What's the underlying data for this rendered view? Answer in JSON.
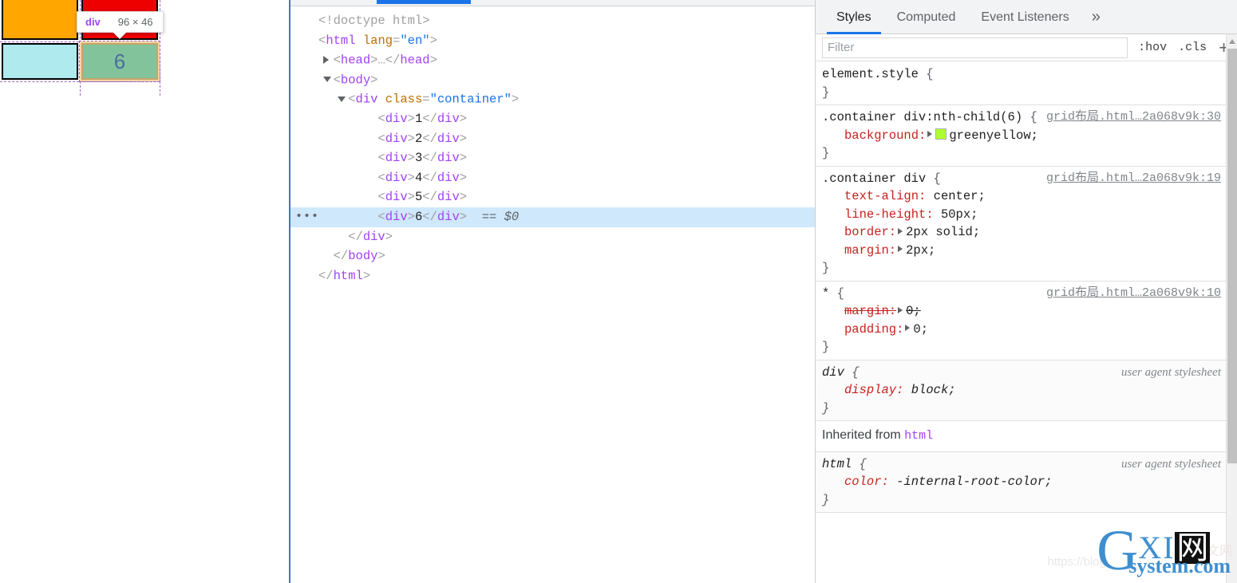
{
  "page": {
    "cells": [
      {
        "label": "",
        "color": "#ffa600",
        "name": "grid-cell-orange"
      },
      {
        "label": "",
        "color": "#ef0000",
        "name": "grid-cell-red"
      },
      {
        "label": "",
        "color": "#aeeaee",
        "name": "grid-cell-cyan"
      },
      {
        "label": "6",
        "color": "greenyellow",
        "name": "grid-cell-selected"
      }
    ],
    "tooltip": {
      "tag": "div",
      "dimensions": "96 × 46"
    }
  },
  "dom": {
    "lines": [
      {
        "indent": 0,
        "triangle": "none",
        "segments": [
          {
            "t": "<!doctype html>",
            "c": "doctype"
          }
        ]
      },
      {
        "indent": 0,
        "triangle": "none",
        "segments": [
          {
            "t": "<",
            "c": "punc"
          },
          {
            "t": "html",
            "c": "tag"
          },
          {
            "t": " ",
            "c": "punc"
          },
          {
            "t": "lang",
            "c": "attr"
          },
          {
            "t": "=",
            "c": "punc"
          },
          {
            "t": "\"en\"",
            "c": "val"
          },
          {
            "t": ">",
            "c": "punc"
          }
        ]
      },
      {
        "indent": 1,
        "triangle": "closed",
        "segments": [
          {
            "t": "<",
            "c": "punc"
          },
          {
            "t": "head",
            "c": "tag"
          },
          {
            "t": ">",
            "c": "punc"
          },
          {
            "t": "…",
            "c": "punc"
          },
          {
            "t": "</",
            "c": "punc"
          },
          {
            "t": "head",
            "c": "tag"
          },
          {
            "t": ">",
            "c": "punc"
          }
        ]
      },
      {
        "indent": 1,
        "triangle": "open",
        "segments": [
          {
            "t": "<",
            "c": "punc"
          },
          {
            "t": "body",
            "c": "tag"
          },
          {
            "t": ">",
            "c": "punc"
          }
        ]
      },
      {
        "indent": 2,
        "triangle": "open",
        "segments": [
          {
            "t": "<",
            "c": "punc"
          },
          {
            "t": "div",
            "c": "tag"
          },
          {
            "t": " ",
            "c": "punc"
          },
          {
            "t": "class",
            "c": "attr"
          },
          {
            "t": "=",
            "c": "punc"
          },
          {
            "t": "\"container\"",
            "c": "val"
          },
          {
            "t": ">",
            "c": "punc"
          }
        ]
      },
      {
        "indent": 4,
        "triangle": "none",
        "segments": [
          {
            "t": "<",
            "c": "punc"
          },
          {
            "t": "div",
            "c": "tag"
          },
          {
            "t": ">",
            "c": "punc"
          },
          {
            "t": "1",
            "c": "txt"
          },
          {
            "t": "</",
            "c": "punc"
          },
          {
            "t": "div",
            "c": "tag"
          },
          {
            "t": ">",
            "c": "punc"
          }
        ]
      },
      {
        "indent": 4,
        "triangle": "none",
        "segments": [
          {
            "t": "<",
            "c": "punc"
          },
          {
            "t": "div",
            "c": "tag"
          },
          {
            "t": ">",
            "c": "punc"
          },
          {
            "t": "2",
            "c": "txt"
          },
          {
            "t": "</",
            "c": "punc"
          },
          {
            "t": "div",
            "c": "tag"
          },
          {
            "t": ">",
            "c": "punc"
          }
        ]
      },
      {
        "indent": 4,
        "triangle": "none",
        "segments": [
          {
            "t": "<",
            "c": "punc"
          },
          {
            "t": "div",
            "c": "tag"
          },
          {
            "t": ">",
            "c": "punc"
          },
          {
            "t": "3",
            "c": "txt"
          },
          {
            "t": "</",
            "c": "punc"
          },
          {
            "t": "div",
            "c": "tag"
          },
          {
            "t": ">",
            "c": "punc"
          }
        ]
      },
      {
        "indent": 4,
        "triangle": "none",
        "segments": [
          {
            "t": "<",
            "c": "punc"
          },
          {
            "t": "div",
            "c": "tag"
          },
          {
            "t": ">",
            "c": "punc"
          },
          {
            "t": "4",
            "c": "txt"
          },
          {
            "t": "</",
            "c": "punc"
          },
          {
            "t": "div",
            "c": "tag"
          },
          {
            "t": ">",
            "c": "punc"
          }
        ]
      },
      {
        "indent": 4,
        "triangle": "none",
        "segments": [
          {
            "t": "<",
            "c": "punc"
          },
          {
            "t": "div",
            "c": "tag"
          },
          {
            "t": ">",
            "c": "punc"
          },
          {
            "t": "5",
            "c": "txt"
          },
          {
            "t": "</",
            "c": "punc"
          },
          {
            "t": "div",
            "c": "tag"
          },
          {
            "t": ">",
            "c": "punc"
          }
        ]
      },
      {
        "indent": 4,
        "triangle": "none",
        "selected": true,
        "ellipsis": "•••",
        "segments": [
          {
            "t": "<",
            "c": "punc"
          },
          {
            "t": "div",
            "c": "tag"
          },
          {
            "t": ">",
            "c": "punc"
          },
          {
            "t": "6",
            "c": "txt"
          },
          {
            "t": "</",
            "c": "punc"
          },
          {
            "t": "div",
            "c": "tag"
          },
          {
            "t": ">",
            "c": "punc"
          },
          {
            "t": "  == $0",
            "c": "eqdollar"
          }
        ]
      },
      {
        "indent": 2,
        "triangle": "none",
        "segments": [
          {
            "t": "</",
            "c": "punc"
          },
          {
            "t": "div",
            "c": "tag"
          },
          {
            "t": ">",
            "c": "punc"
          }
        ]
      },
      {
        "indent": 1,
        "triangle": "none",
        "segments": [
          {
            "t": "</",
            "c": "punc"
          },
          {
            "t": "body",
            "c": "tag"
          },
          {
            "t": ">",
            "c": "punc"
          }
        ]
      },
      {
        "indent": 0,
        "triangle": "none",
        "segments": [
          {
            "t": "</",
            "c": "punc"
          },
          {
            "t": "html",
            "c": "tag"
          },
          {
            "t": ">",
            "c": "punc"
          }
        ]
      }
    ]
  },
  "styles": {
    "tabs": [
      {
        "label": "Styles",
        "active": true
      },
      {
        "label": "Computed",
        "active": false
      },
      {
        "label": "Event Listeners",
        "active": false
      }
    ],
    "more_label": "»",
    "filter_placeholder": "Filter",
    "filter_value": "",
    "hov_label": ":hov",
    "cls_label": ".cls",
    "plus_label": "+",
    "inherited_label": "Inherited from",
    "inherited_tag": "html",
    "rules": [
      {
        "selector": "element.style",
        "source": "",
        "ua": false,
        "declarations": []
      },
      {
        "selector": ".container div:nth-child(6)",
        "source": "grid布局.html…2a068v9k:30",
        "ua": false,
        "declarations": [
          {
            "prop": "background",
            "value": "greenyellow",
            "expander": true,
            "swatch": "#adff2f",
            "struck": false
          }
        ]
      },
      {
        "selector": ".container div",
        "source": "grid布局.html…2a068v9k:19",
        "ua": false,
        "declarations": [
          {
            "prop": "text-align",
            "value": "center",
            "expander": false,
            "struck": false
          },
          {
            "prop": "line-height",
            "value": "50px",
            "expander": false,
            "struck": false
          },
          {
            "prop": "border",
            "value": "2px solid",
            "expander": true,
            "struck": false
          },
          {
            "prop": "margin",
            "value": "2px",
            "expander": true,
            "struck": false
          }
        ]
      },
      {
        "selector": "*",
        "source": "grid布局.html…2a068v9k:10",
        "ua": false,
        "declarations": [
          {
            "prop": "margin",
            "value": "0",
            "expander": true,
            "struck": true
          },
          {
            "prop": "padding",
            "value": "0",
            "expander": true,
            "struck": false
          }
        ]
      },
      {
        "selector": "div",
        "source": "user agent stylesheet",
        "ua": true,
        "declarations": [
          {
            "prop": "display",
            "value": "block",
            "expander": false,
            "struck": false
          }
        ]
      },
      {
        "selector": "html",
        "source": "user agent stylesheet",
        "ua": true,
        "declarations": [
          {
            "prop": "color",
            "value": "-internal-root-color",
            "expander": false,
            "struck": false
          }
        ]
      }
    ]
  },
  "watermark": {
    "letter": "G",
    "xi": "XI",
    "wang": "网",
    "domain": "system.com",
    "url": "https://blog."
  }
}
